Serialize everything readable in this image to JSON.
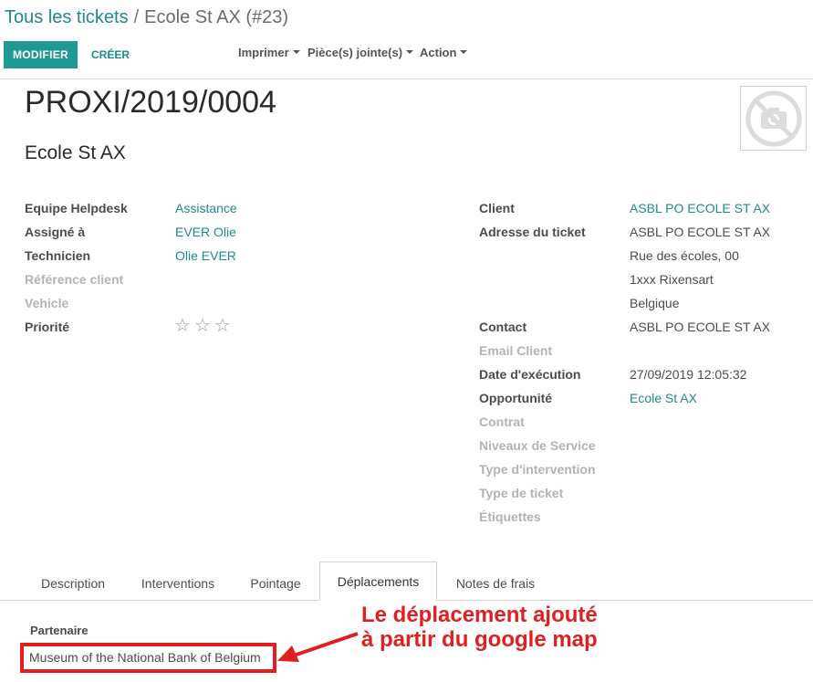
{
  "breadcrumb": {
    "parent": "Tous les tickets",
    "separator": "/",
    "current": "Ecole St AX (#23)"
  },
  "toolbar": {
    "edit_label": "MODIFIER",
    "create_label": "CRÉER",
    "print_label": "Imprimer",
    "attachments_label": "Pièce(s) jointe(s)",
    "action_label": "Action"
  },
  "record": {
    "title": "PROXI/2019/0004",
    "name": "Ecole St AX"
  },
  "left_fields": {
    "team_label": "Equipe Helpdesk",
    "team_value": "Assistance",
    "assigned_label": "Assigné à",
    "assigned_value": "EVER Olie",
    "technician_label": "Technicien",
    "technician_value": "Olie EVER",
    "client_ref_label": "Référence client",
    "vehicle_label": "Vehicle",
    "priority_label": "Priorité",
    "priority_stars": {
      "filled": 0,
      "total": 3
    }
  },
  "right_fields": {
    "client_label": "Client",
    "client_value": "ASBL PO ECOLE ST AX",
    "address_label": "Adresse du ticket",
    "address_line1": "ASBL PO ECOLE ST AX",
    "address_line2": "Rue des écoles, 00",
    "address_line3": "1xxx Rixensart",
    "address_line4": "Belgique",
    "contact_label": "Contact",
    "contact_value": "ASBL PO ECOLE ST AX",
    "email_label": "Email Client",
    "exec_date_label": "Date d'exécution",
    "exec_date_value": "27/09/2019 12:05:32",
    "opportunity_label": "Opportunité",
    "opportunity_value": "Ecole St AX",
    "contract_label": "Contrat",
    "service_levels_label": "Niveaux de Service",
    "intervention_type_label": "Type d'intervention",
    "ticket_type_label": "Type de ticket",
    "tags_label": "Étiquettes"
  },
  "tabs": {
    "description": "Description",
    "interventions": "Interventions",
    "timesheet": "Pointage",
    "travel": "Déplacements",
    "expenses": "Notes de frais"
  },
  "travel_tab": {
    "partner_label": "Partenaire",
    "partner_value": "Museum of the National Bank of Belgium"
  },
  "annotation": {
    "line1": "Le déplacement ajouté",
    "line2": "à partir du google map"
  },
  "colors": {
    "accent": "#1f9a93",
    "link": "#1f8a8a",
    "annotation": "#e02020"
  }
}
